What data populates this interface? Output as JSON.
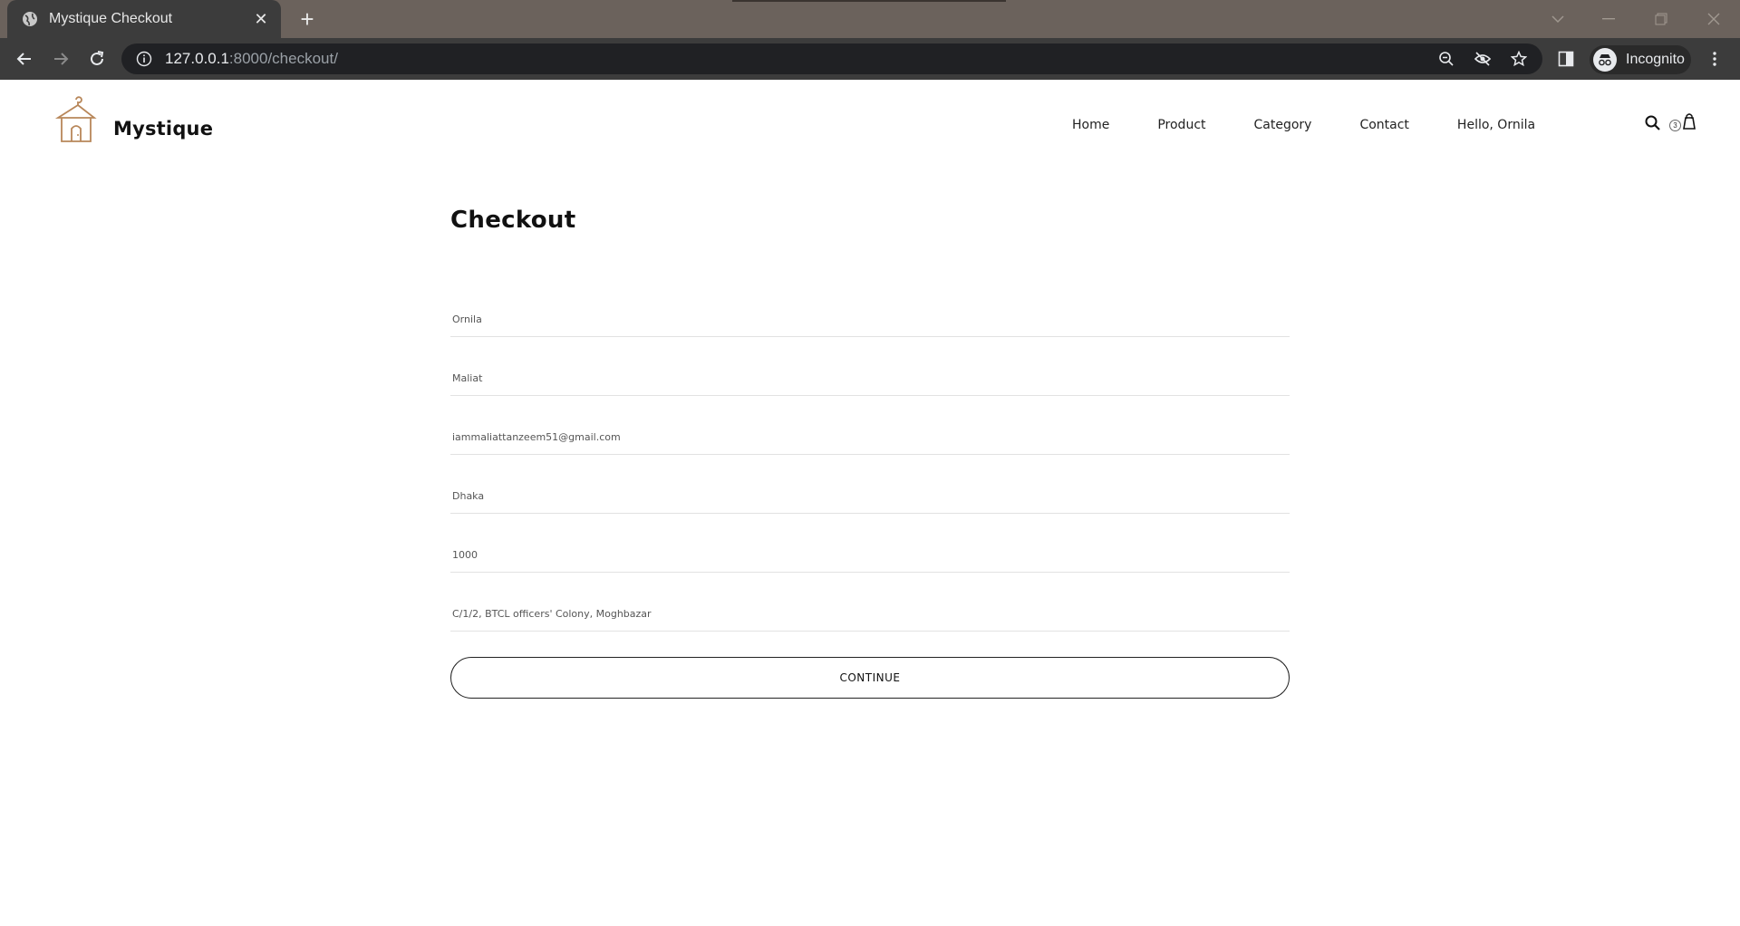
{
  "browser": {
    "tab_title": "Mystique Checkout",
    "new_tab_label": "+",
    "url_host": "127.0.0.1",
    "url_rest": ":8000/checkout/",
    "profile_label": "Incognito"
  },
  "site": {
    "brand": "Mystique",
    "nav": [
      "Home",
      "Product",
      "Category",
      "Contact",
      "Hello, Ornila"
    ],
    "cart_count": "3"
  },
  "checkout": {
    "title": "Checkout",
    "fields": [
      {
        "name": "first-name-field",
        "value": "Ornila"
      },
      {
        "name": "last-name-field",
        "value": "Maliat"
      },
      {
        "name": "email-field",
        "value": "iammaliattanzeem51@gmail.com"
      },
      {
        "name": "city-field",
        "value": "Dhaka"
      },
      {
        "name": "postal-code-field",
        "value": "1000"
      },
      {
        "name": "address-field",
        "value": "C/1/2, BTCL officers' Colony, Moghbazar"
      }
    ],
    "continue_label": "CONTINUE"
  },
  "icons": {
    "accent": "#b8875a"
  }
}
